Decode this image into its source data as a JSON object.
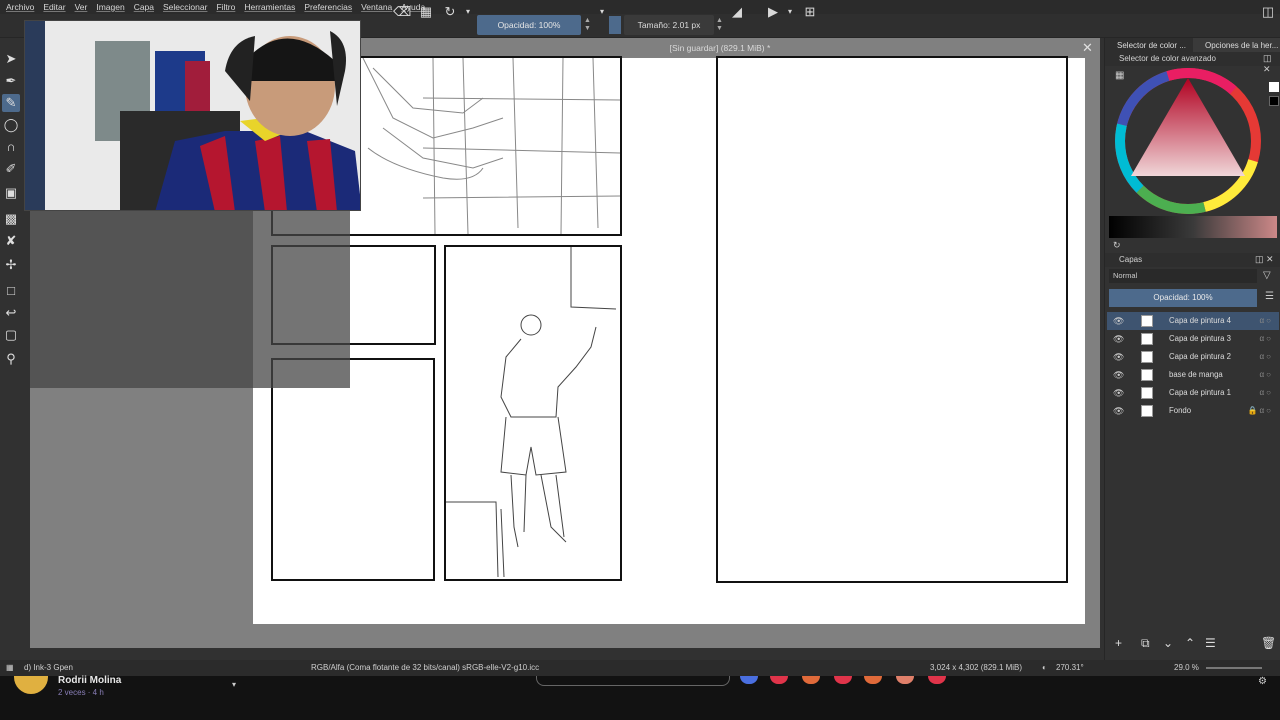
{
  "menu": [
    "Archivo",
    "Editar",
    "Ver",
    "Imagen",
    "Capa",
    "Seleccionar",
    "Filtro",
    "Herramientas",
    "Preferencias",
    "Ventana",
    "Ayuda"
  ],
  "options_bar": {
    "opacity_label": "Opacidad: 100%",
    "size_label": "Tamaño: 2.01 px"
  },
  "document": {
    "title": "[Sin guardar]  (829.1 MiB) *"
  },
  "docker": {
    "tabs": [
      "Selector de color ...",
      "Opciones de la her..."
    ],
    "color_selector_title": "Selector de color avanzado",
    "layers_title": "Capas",
    "blend_mode": "Normal",
    "layer_opacity": "Opacidad:  100%",
    "layers": [
      {
        "name": "Capa de pintura 4",
        "selected": true
      },
      {
        "name": "Capa de pintura 3",
        "selected": false
      },
      {
        "name": "Capa de pintura 2",
        "selected": false
      },
      {
        "name": "base de manga",
        "selected": false
      },
      {
        "name": "Capa de pintura 1",
        "selected": false
      },
      {
        "name": "Fondo",
        "selected": false
      }
    ]
  },
  "status": {
    "brush": "d) Ink-3 Gpen",
    "color_space": "RGB/Alfa (Coma flotante de 32 bits/canal)  sRGB-elle-V2-g10.icc",
    "dimensions": "3,024 x 4,302 (829.1 MiB)",
    "rotation": "270.31°",
    "zoom": "29.0 %"
  },
  "taskbar": {
    "user_name": "Rodrii Molina",
    "user_sub": "2 veces · 4 h"
  },
  "colors": {
    "accent": "#4d6a8c",
    "dock_bg": "#323232",
    "canvas_bg": "#808080"
  }
}
